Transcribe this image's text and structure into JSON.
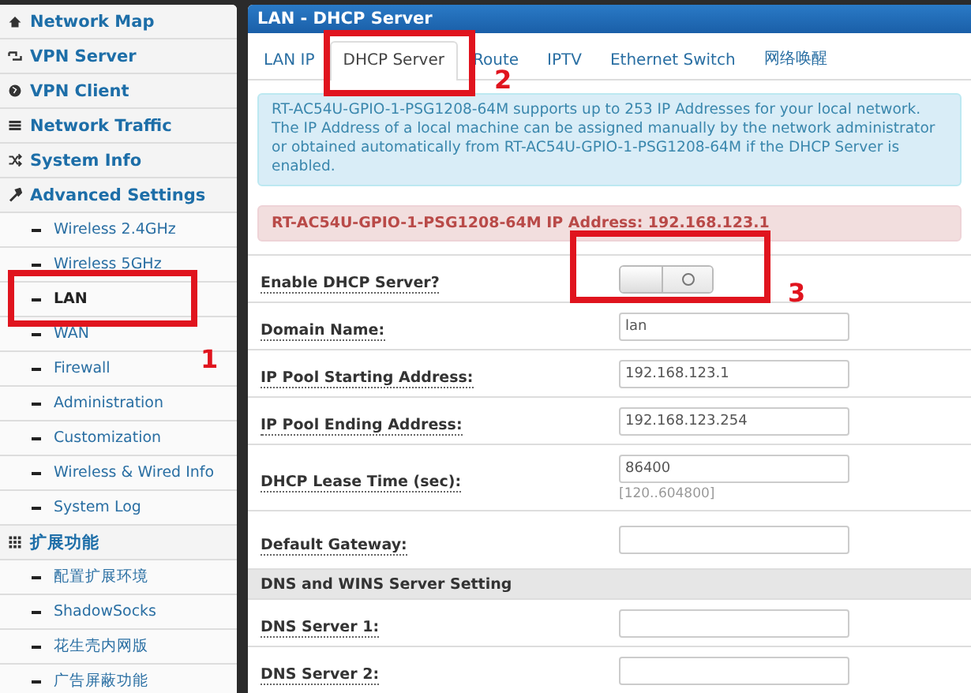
{
  "sidebar": {
    "items": [
      {
        "label": "Network Map",
        "kind": "section",
        "selected": false
      },
      {
        "label": "VPN Server",
        "kind": "section",
        "selected": false
      },
      {
        "label": "VPN Client",
        "kind": "section",
        "selected": false
      },
      {
        "label": "Network Traffic",
        "kind": "section",
        "selected": false
      },
      {
        "label": "System Info",
        "kind": "section",
        "selected": false
      },
      {
        "label": "Advanced Settings",
        "kind": "section",
        "selected": false
      },
      {
        "label": "Wireless 2.4GHz",
        "kind": "sub",
        "selected": false
      },
      {
        "label": "Wireless 5GHz",
        "kind": "sub",
        "selected": false
      },
      {
        "label": "LAN",
        "kind": "sub",
        "selected": true
      },
      {
        "label": "WAN",
        "kind": "sub",
        "selected": false
      },
      {
        "label": "Firewall",
        "kind": "sub",
        "selected": false
      },
      {
        "label": "Administration",
        "kind": "sub",
        "selected": false
      },
      {
        "label": "Customization",
        "kind": "sub",
        "selected": false
      },
      {
        "label": "Wireless & Wired Info",
        "kind": "sub",
        "selected": false
      },
      {
        "label": "System Log",
        "kind": "sub",
        "selected": false
      },
      {
        "label": "扩展功能",
        "kind": "section",
        "selected": false
      },
      {
        "label": "配置扩展环境",
        "kind": "sub",
        "selected": false
      },
      {
        "label": "ShadowSocks",
        "kind": "sub",
        "selected": false
      },
      {
        "label": "花生壳内网版",
        "kind": "sub",
        "selected": false
      },
      {
        "label": "广告屏蔽功能",
        "kind": "sub",
        "selected": false
      }
    ]
  },
  "panel": {
    "title": "LAN - DHCP Server",
    "tabs": [
      {
        "label": "LAN IP",
        "selected": false
      },
      {
        "label": "DHCP Server",
        "selected": true
      },
      {
        "label": "Route",
        "selected": false
      },
      {
        "label": "IPTV",
        "selected": false
      },
      {
        "label": "Ethernet Switch",
        "selected": false
      },
      {
        "label": "网络唤醒",
        "selected": false
      }
    ],
    "info": "RT-AC54U-GPIO-1-PSG1208-64M supports up to 253 IP Addresses for your local network. The IP Address of a local machine can be assigned manually by the network administrator or obtained automatically from RT-AC54U-GPIO-1-PSG1208-64M if the DHCP Server is enabled.",
    "alert": "RT-AC54U-GPIO-1-PSG1208-64M IP Address: 192.168.123.1",
    "rows": [
      {
        "kind": "toggle",
        "label": "Enable DHCP Server?",
        "on": false
      },
      {
        "kind": "field",
        "label": "Domain Name:",
        "value": "lan"
      },
      {
        "kind": "field",
        "label": "IP Pool Starting Address:",
        "value": "192.168.123.1"
      },
      {
        "kind": "field",
        "label": "IP Pool Ending Address:",
        "value": "192.168.123.254"
      },
      {
        "kind": "field",
        "label": "DHCP Lease Time (sec):",
        "value": "86400",
        "hint": "[120..604800]"
      },
      {
        "kind": "field",
        "label": "Default Gateway:"
      },
      {
        "kind": "header",
        "label": "DNS and WINS Server Setting"
      },
      {
        "kind": "field",
        "label": "DNS Server 1:"
      },
      {
        "kind": "field",
        "label": "DNS Server 2:"
      }
    ]
  },
  "annotations": [
    {
      "number": "1"
    },
    {
      "number": "2"
    },
    {
      "number": "3"
    }
  ]
}
